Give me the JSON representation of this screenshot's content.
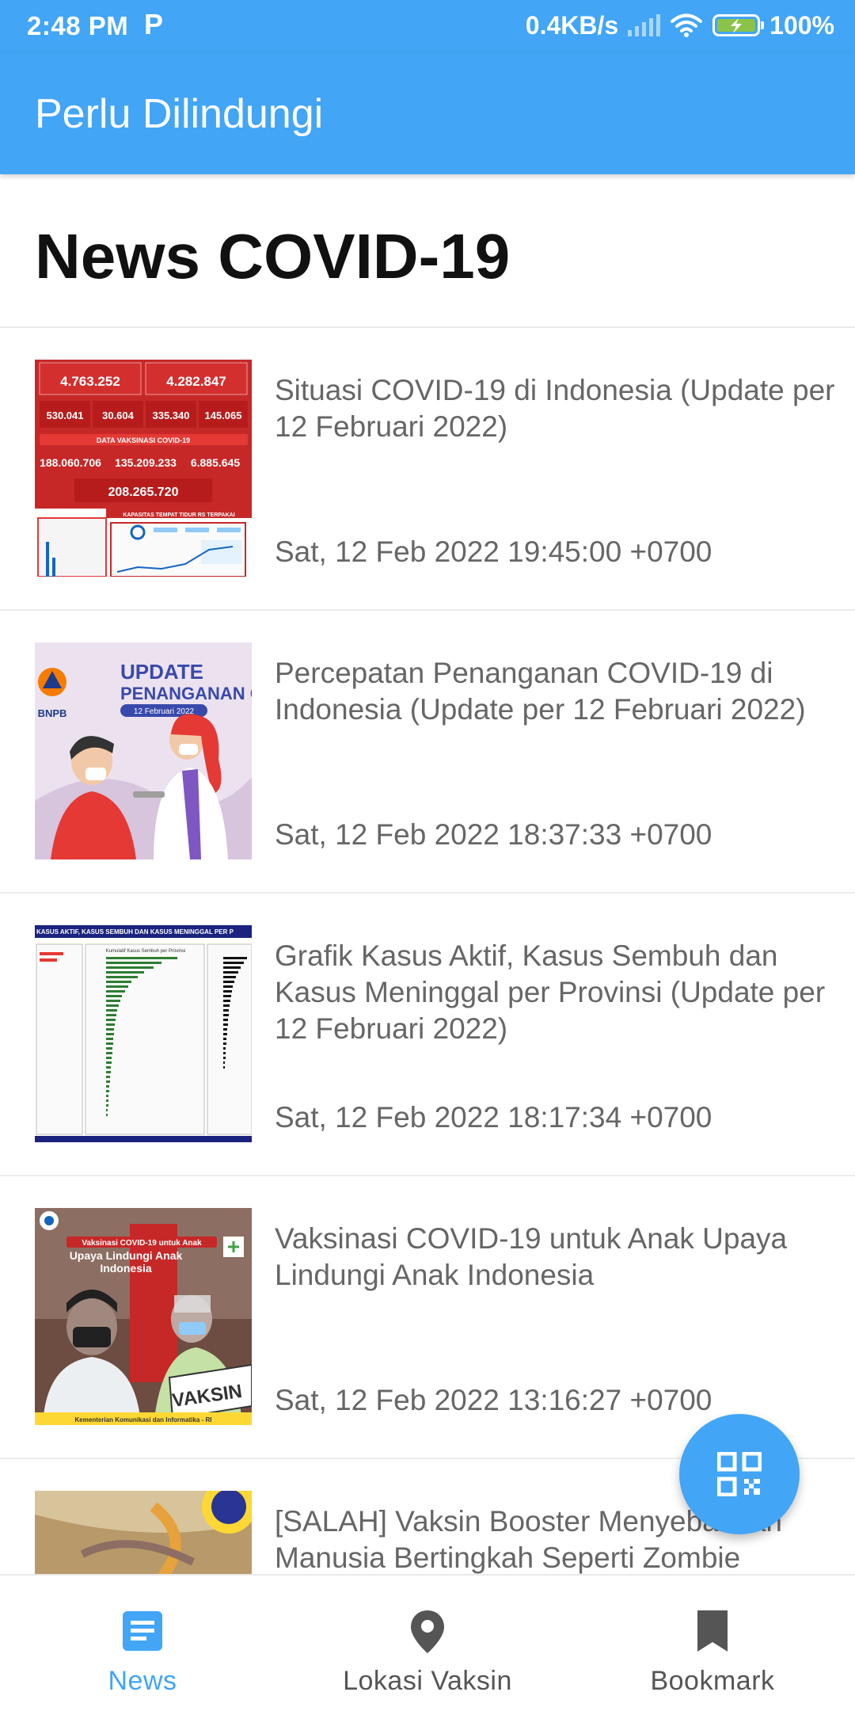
{
  "status_bar": {
    "time": "2:48 PM",
    "notification_icon": "P",
    "net_speed": "0.4KB/s",
    "battery": "100%"
  },
  "app_bar": {
    "title": "Perlu Dilindungi"
  },
  "section_title": "News COVID-19",
  "news": [
    {
      "title": "Situasi COVID-19 di Indonesia (Update per 12 Februari 2022)",
      "date": "Sat, 12 Feb 2022 19:45:00 +0700",
      "thumb": {
        "row1": [
          "4.763.252",
          "4.282.847"
        ],
        "row2": [
          "530.041",
          "30.604",
          "335.340",
          "145.065"
        ],
        "band": "DATA VAKSINASI COVID-19",
        "row3": [
          "188.060.706",
          "135.209.233",
          "6.885.645"
        ],
        "total": "208.265.720",
        "bed": "KAPASITAS TEMPAT TIDUR RS TERPAKAI"
      }
    },
    {
      "title": "Percepatan Penanganan COVID-19 di Indonesia (Update per 12 Februari 2022)",
      "date": "Sat, 12 Feb 2022 18:37:33 +0700",
      "thumb": {
        "line1": "UPDATE",
        "line2": "PENANGANAN COV",
        "badge": "12 Februari 2022",
        "org": "BNPB"
      }
    },
    {
      "title": "Grafik Kasus Aktif, Kasus Sembuh dan Kasus Meninggal per Provinsi (Update per 12 Februari 2022)",
      "date": "Sat, 12 Feb 2022 18:17:34 +0700",
      "thumb": {
        "header": "KASUS AKTIF, KASUS SEMBUH DAN KASUS MENINGGAL PER P",
        "chart": "Kumulatif Kasus Sembuh per Provinsi"
      }
    },
    {
      "title": "Vaksinasi COVID-19 untuk Anak Upaya Lindungi Anak Indonesia",
      "date": "Sat, 12 Feb 2022 13:16:27 +0700",
      "thumb": {
        "tag": "Vaksinasi COVID-19 untuk Anak",
        "headline": "Upaya Lindungi Anak Indonesia",
        "sign": "VAKSIN",
        "footer": "Kementerian Komunikasi dan Informatika - RI"
      }
    },
    {
      "title": "[SALAH] Vaksin Booster Menyebabkan Manusia Bertingkah Seperti Zombie",
      "date": "",
      "thumb": {}
    }
  ],
  "fab": {
    "icon": "qr-code-icon"
  },
  "bottom_nav": [
    {
      "label": "News",
      "icon": "news-icon",
      "active": true
    },
    {
      "label": "Lokasi Vaksin",
      "icon": "location-pin-icon",
      "active": false
    },
    {
      "label": "Bookmark",
      "icon": "bookmark-icon",
      "active": false
    }
  ],
  "colors": {
    "primary": "#42A5F5",
    "text_secondary": "#666666"
  }
}
